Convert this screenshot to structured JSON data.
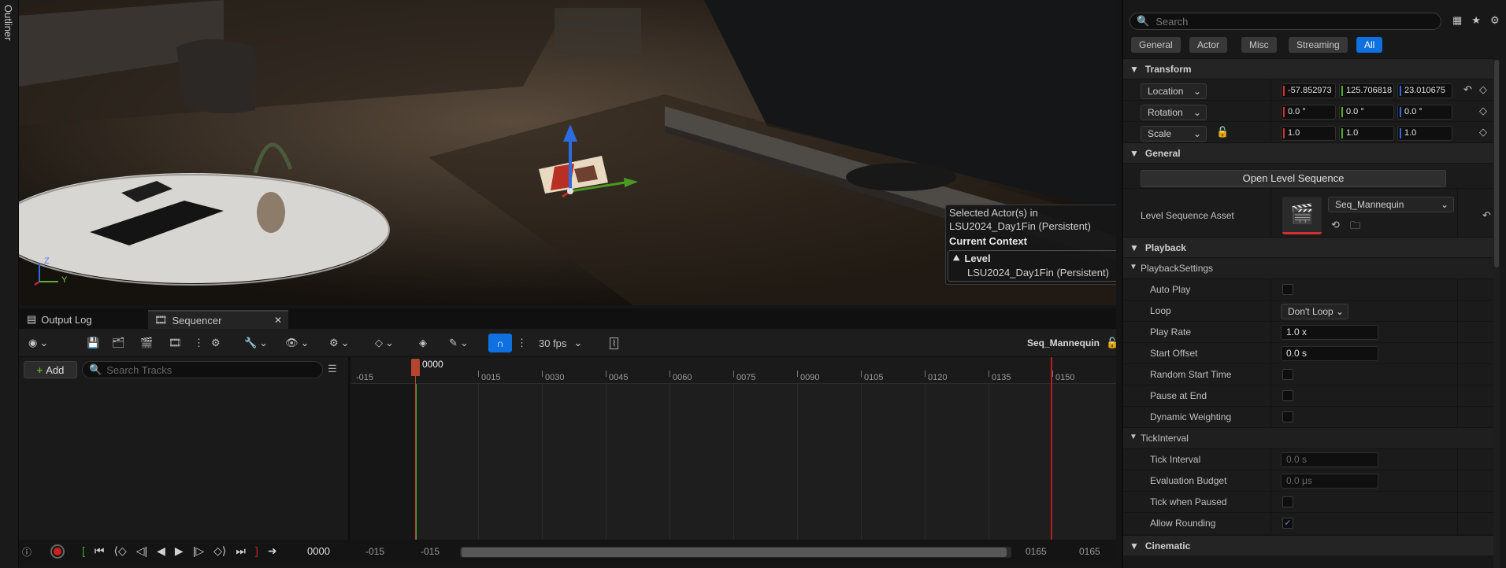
{
  "outliner": {
    "label": "Outliner"
  },
  "viewport": {
    "context": {
      "selected_line1": "Selected Actor(s) in",
      "selected_line2": "LSU2024_Day1Fin (Persistent)",
      "current_context": "Current Context",
      "level_label": "Level",
      "level_value": "LSU2024_Day1Fin (Persistent)"
    },
    "axis_z": "Z",
    "axis_y": "Y"
  },
  "tabs": [
    {
      "label": "Output Log"
    },
    {
      "label": "Sequencer"
    }
  ],
  "toolbar": {
    "fps": "30 fps",
    "sequence_name": "Seq_Mannequin"
  },
  "tracks": {
    "add_label": "Add",
    "search_placeholder": "Search Tracks"
  },
  "timeline": {
    "current_frame": "0000",
    "ticks": [
      "-015",
      "0015",
      "0030",
      "0045",
      "0060",
      "0075",
      "0090",
      "0105",
      "0120",
      "0135",
      "0150"
    ],
    "range_start_a": "-015",
    "range_start_b": "-015",
    "range_end_a": "0165",
    "range_end_b": "0165"
  },
  "transport": {
    "frame": "0000"
  },
  "details": {
    "search_placeholder": "Search",
    "filters": [
      "General",
      "Actor",
      "Misc",
      "Streaming",
      "All"
    ],
    "active_filter": "All",
    "transform": {
      "title": "Transform",
      "location_label": "Location",
      "rotation_label": "Rotation",
      "scale_label": "Scale",
      "location": [
        "-57.852973",
        "125.706818",
        "23.010675"
      ],
      "rotation": [
        "0.0 °",
        "0.0 °",
        "0.0 °"
      ],
      "scale": [
        "1.0",
        "1.0",
        "1.0"
      ]
    },
    "general": {
      "title": "General",
      "open_button": "Open Level Sequence",
      "asset_label": "Level Sequence Asset",
      "asset_value": "Seq_Mannequin"
    },
    "playback": {
      "title": "Playback",
      "settings_title": "PlaybackSettings",
      "auto_play": "Auto Play",
      "loop": "Loop",
      "loop_value": "Don't Loop",
      "play_rate": "Play Rate",
      "play_rate_value": "1.0 x",
      "start_offset": "Start Offset",
      "start_offset_value": "0.0 s",
      "random_start": "Random Start Time",
      "pause_end": "Pause at End",
      "dynamic_weighting": "Dynamic Weighting"
    },
    "tick": {
      "title": "TickInterval",
      "tick_interval": "Tick Interval",
      "tick_interval_value": "0.0 s",
      "evaluation_budget": "Evaluation Budget",
      "evaluation_budget_value": "0.0 μs",
      "tick_when_paused": "Tick when Paused",
      "allow_rounding": "Allow Rounding"
    },
    "cinematic": {
      "title": "Cinematic"
    }
  },
  "colors": {
    "accent": "#0f70e0",
    "x_axis": "#d03030",
    "y_axis": "#5ab02a",
    "z_axis": "#2d6be0",
    "record": "#d02020"
  }
}
